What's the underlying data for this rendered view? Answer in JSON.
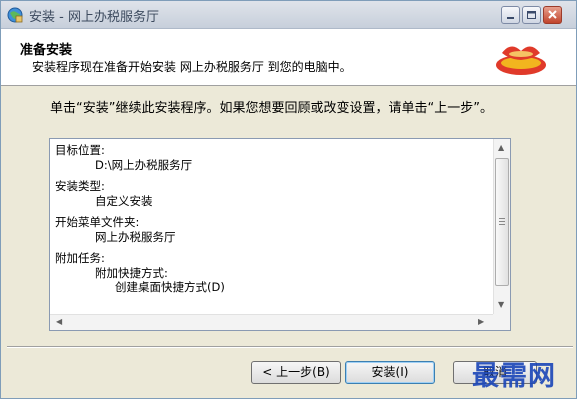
{
  "window": {
    "title": "安装 - 网上办税服务厅"
  },
  "header": {
    "title": "准备安装",
    "subtitle": "安装程序现在准备开始安装 网上办税服务厅 到您的电脑中。"
  },
  "description": "单击“安装”继续此安装程序。如果您想要回顾或改变设置，请单击“上一步”。",
  "summary": {
    "dest_label": "目标位置:",
    "dest_value": "D:\\网上办税服务厅",
    "type_label": "安装类型:",
    "type_value": "自定义安装",
    "menu_label": "开始菜单文件夹:",
    "menu_value": "网上办税服务厅",
    "tasks_label": "附加任务:",
    "tasks_group": "附加快捷方式:",
    "tasks_item": "创建桌面快捷方式(D)"
  },
  "buttons": {
    "back": "< 上一步(B)",
    "install": "安装(I)",
    "cancel": "取消"
  },
  "watermark": "最需网",
  "icons": {
    "app": "installer-globe-icon",
    "logo": "tax-hall-logo-icon"
  },
  "colors": {
    "close_button": "#c0442c",
    "logo_red": "#e03a2a",
    "logo_yellow": "#f2b51f",
    "watermark": "#1a45b8"
  }
}
